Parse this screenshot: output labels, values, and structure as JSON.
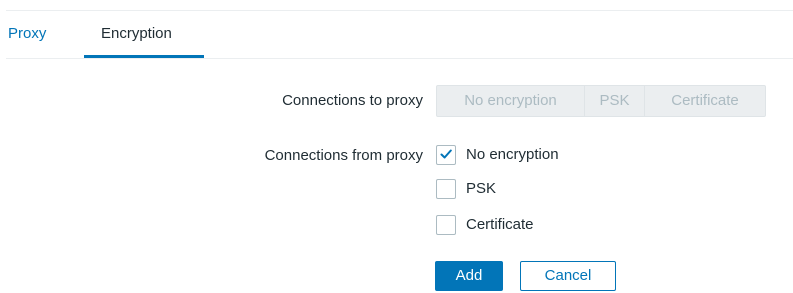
{
  "tabs": {
    "proxy_label": "Proxy",
    "encryption_label": "Encryption",
    "active": "Encryption"
  },
  "connections_to_proxy": {
    "label": "Connections to proxy",
    "options": [
      "No encryption",
      "PSK",
      "Certificate"
    ],
    "disabled": true
  },
  "connections_from_proxy": {
    "label": "Connections from proxy",
    "options": [
      {
        "label": "No encryption",
        "checked": true
      },
      {
        "label": "PSK",
        "checked": false
      },
      {
        "label": "Certificate",
        "checked": false
      }
    ]
  },
  "buttons": {
    "add_label": "Add",
    "cancel_label": "Cancel"
  },
  "colors": {
    "accent": "#0275b8",
    "text": "#1f2c33",
    "disabled_text": "#acbbc2",
    "disabled_bg": "#ebeef0"
  },
  "icons": {
    "check": "check-icon"
  }
}
